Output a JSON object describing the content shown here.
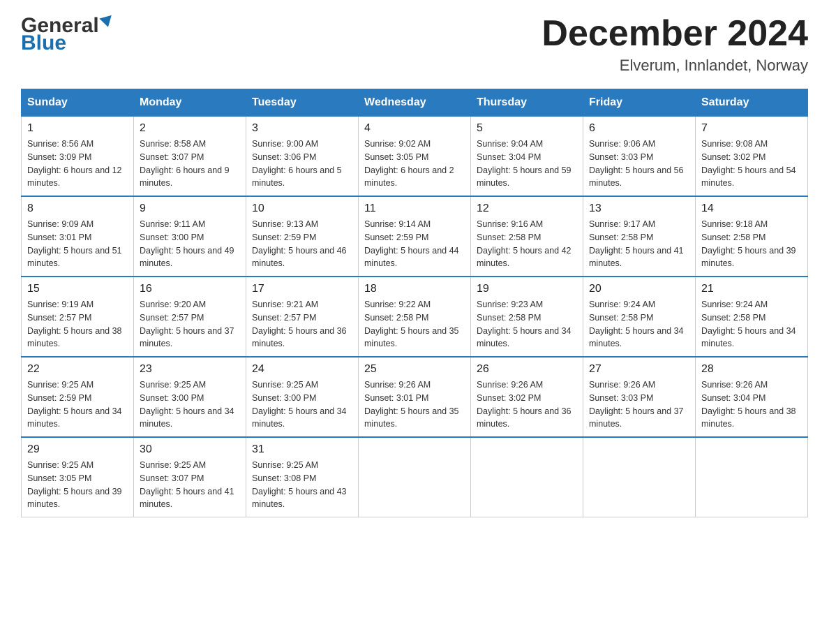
{
  "header": {
    "logo_general": "General",
    "logo_blue": "Blue",
    "month": "December 2024",
    "location": "Elverum, Innlandet, Norway"
  },
  "weekdays": [
    "Sunday",
    "Monday",
    "Tuesday",
    "Wednesday",
    "Thursday",
    "Friday",
    "Saturday"
  ],
  "weeks": [
    [
      {
        "day": "1",
        "sunrise": "8:56 AM",
        "sunset": "3:09 PM",
        "daylight": "6 hours and 12 minutes."
      },
      {
        "day": "2",
        "sunrise": "8:58 AM",
        "sunset": "3:07 PM",
        "daylight": "6 hours and 9 minutes."
      },
      {
        "day": "3",
        "sunrise": "9:00 AM",
        "sunset": "3:06 PM",
        "daylight": "6 hours and 5 minutes."
      },
      {
        "day": "4",
        "sunrise": "9:02 AM",
        "sunset": "3:05 PM",
        "daylight": "6 hours and 2 minutes."
      },
      {
        "day": "5",
        "sunrise": "9:04 AM",
        "sunset": "3:04 PM",
        "daylight": "5 hours and 59 minutes."
      },
      {
        "day": "6",
        "sunrise": "9:06 AM",
        "sunset": "3:03 PM",
        "daylight": "5 hours and 56 minutes."
      },
      {
        "day": "7",
        "sunrise": "9:08 AM",
        "sunset": "3:02 PM",
        "daylight": "5 hours and 54 minutes."
      }
    ],
    [
      {
        "day": "8",
        "sunrise": "9:09 AM",
        "sunset": "3:01 PM",
        "daylight": "5 hours and 51 minutes."
      },
      {
        "day": "9",
        "sunrise": "9:11 AM",
        "sunset": "3:00 PM",
        "daylight": "5 hours and 49 minutes."
      },
      {
        "day": "10",
        "sunrise": "9:13 AM",
        "sunset": "2:59 PM",
        "daylight": "5 hours and 46 minutes."
      },
      {
        "day": "11",
        "sunrise": "9:14 AM",
        "sunset": "2:59 PM",
        "daylight": "5 hours and 44 minutes."
      },
      {
        "day": "12",
        "sunrise": "9:16 AM",
        "sunset": "2:58 PM",
        "daylight": "5 hours and 42 minutes."
      },
      {
        "day": "13",
        "sunrise": "9:17 AM",
        "sunset": "2:58 PM",
        "daylight": "5 hours and 41 minutes."
      },
      {
        "day": "14",
        "sunrise": "9:18 AM",
        "sunset": "2:58 PM",
        "daylight": "5 hours and 39 minutes."
      }
    ],
    [
      {
        "day": "15",
        "sunrise": "9:19 AM",
        "sunset": "2:57 PM",
        "daylight": "5 hours and 38 minutes."
      },
      {
        "day": "16",
        "sunrise": "9:20 AM",
        "sunset": "2:57 PM",
        "daylight": "5 hours and 37 minutes."
      },
      {
        "day": "17",
        "sunrise": "9:21 AM",
        "sunset": "2:57 PM",
        "daylight": "5 hours and 36 minutes."
      },
      {
        "day": "18",
        "sunrise": "9:22 AM",
        "sunset": "2:58 PM",
        "daylight": "5 hours and 35 minutes."
      },
      {
        "day": "19",
        "sunrise": "9:23 AM",
        "sunset": "2:58 PM",
        "daylight": "5 hours and 34 minutes."
      },
      {
        "day": "20",
        "sunrise": "9:24 AM",
        "sunset": "2:58 PM",
        "daylight": "5 hours and 34 minutes."
      },
      {
        "day": "21",
        "sunrise": "9:24 AM",
        "sunset": "2:58 PM",
        "daylight": "5 hours and 34 minutes."
      }
    ],
    [
      {
        "day": "22",
        "sunrise": "9:25 AM",
        "sunset": "2:59 PM",
        "daylight": "5 hours and 34 minutes."
      },
      {
        "day": "23",
        "sunrise": "9:25 AM",
        "sunset": "3:00 PM",
        "daylight": "5 hours and 34 minutes."
      },
      {
        "day": "24",
        "sunrise": "9:25 AM",
        "sunset": "3:00 PM",
        "daylight": "5 hours and 34 minutes."
      },
      {
        "day": "25",
        "sunrise": "9:26 AM",
        "sunset": "3:01 PM",
        "daylight": "5 hours and 35 minutes."
      },
      {
        "day": "26",
        "sunrise": "9:26 AM",
        "sunset": "3:02 PM",
        "daylight": "5 hours and 36 minutes."
      },
      {
        "day": "27",
        "sunrise": "9:26 AM",
        "sunset": "3:03 PM",
        "daylight": "5 hours and 37 minutes."
      },
      {
        "day": "28",
        "sunrise": "9:26 AM",
        "sunset": "3:04 PM",
        "daylight": "5 hours and 38 minutes."
      }
    ],
    [
      {
        "day": "29",
        "sunrise": "9:25 AM",
        "sunset": "3:05 PM",
        "daylight": "5 hours and 39 minutes."
      },
      {
        "day": "30",
        "sunrise": "9:25 AM",
        "sunset": "3:07 PM",
        "daylight": "5 hours and 41 minutes."
      },
      {
        "day": "31",
        "sunrise": "9:25 AM",
        "sunset": "3:08 PM",
        "daylight": "5 hours and 43 minutes."
      },
      null,
      null,
      null,
      null
    ]
  ]
}
